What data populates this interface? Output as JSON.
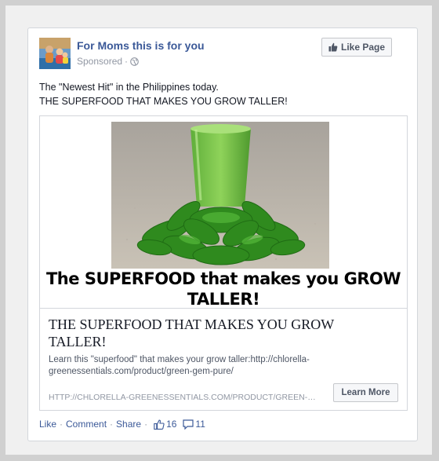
{
  "post": {
    "page_name": "For Moms this is for you",
    "sponsored_label": "Sponsored",
    "meta_separator": "·",
    "like_page_label": "Like Page",
    "text_line1": "The \"Newest Hit\" in the Philippines today.",
    "text_line2": "THE SUPERFOOD THAT MAKES YOU GROW TALLER!"
  },
  "link": {
    "image_caption_line1": "The SUPERFOOD that makes you GROW",
    "image_caption_line2": "TALLER!",
    "title_line1": "THE SUPERFOOD THAT MAKES YOU GROW",
    "title_line2": "TALLER!",
    "description_line1": "Learn this \"superfood\" that makes your grow taller:http://chlorella-",
    "description_line2": "greenessentials.com/product/green-gem-pure/",
    "url": "HTTP://CHLORELLA-GREENESSENTIALS.COM/PRODUCT/GREEN-…",
    "cta_label": "Learn More"
  },
  "actions": {
    "like_label": "Like",
    "comment_label": "Comment",
    "share_label": "Share",
    "separator": "·",
    "like_count": "16",
    "comment_count": "11"
  },
  "icons": {
    "like_page": "thumbs-up-icon",
    "audience": "globe-icon",
    "likes": "thumbs-up-icon",
    "comments": "comment-icon"
  },
  "colors": {
    "link_blue": "#3b5998",
    "muted_gray": "#9197a3",
    "button_bg": "#f6f7f9"
  }
}
